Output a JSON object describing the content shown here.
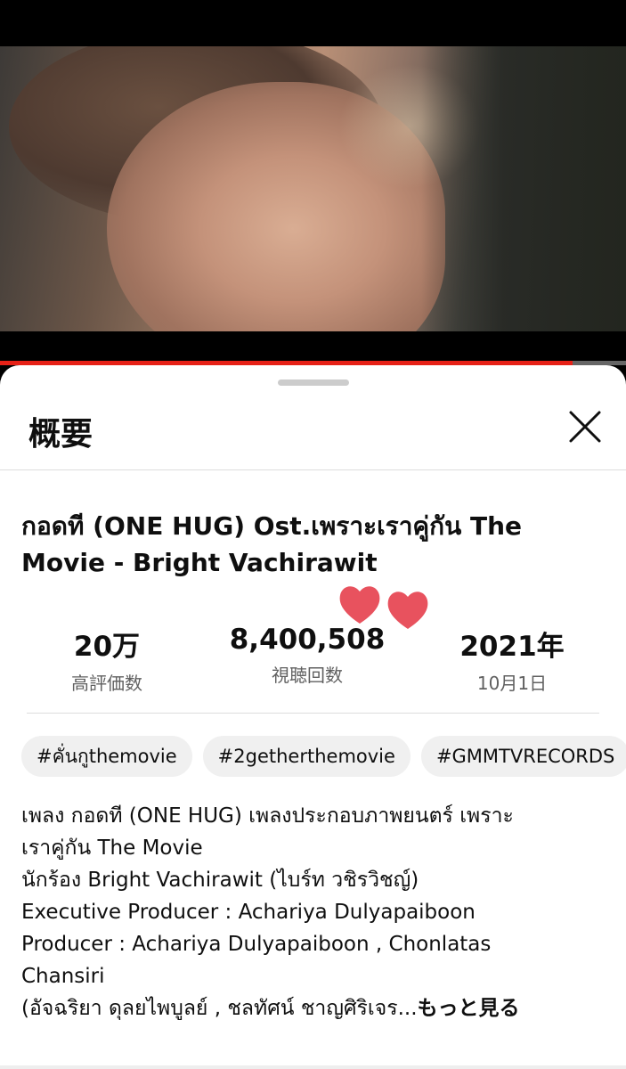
{
  "player": {
    "progress_fraction": 0.915,
    "accent_color": "#e62117"
  },
  "sheet": {
    "title": "概要",
    "close_icon": "close-icon"
  },
  "video": {
    "title_line1": "กอดที (ONE HUG) Ost.เพราะเราคู่กัน The",
    "title_line2": "Movie - Bright Vachirawit"
  },
  "stats": [
    {
      "value": "20万",
      "label": "高評価数"
    },
    {
      "value": "8,400,508",
      "label": "視聴回数"
    },
    {
      "value": "2021年",
      "label": "10月1日"
    }
  ],
  "tags": [
    "#คั่นกูthemovie",
    "#2getherthemovie",
    "#GMMTVRECORDS"
  ],
  "description": {
    "lines": [
      "เพลง กอดที (ONE HUG) เพลงประกอบภาพยนตร์ เพราะ",
      "เราคู่กัน The Movie",
      "นักร้อง Bright Vachirawit (ไบร์ท วชิรวิชญ์)",
      "Executive Producer : Achariya Dulyapaiboon",
      "Producer : Achariya Dulyapaiboon , Chonlatas",
      "Chansiri",
      "(อัจฉริยา ดุลยไพบูลย์ , ชลทัศน์ ชาญศิริเจร..."
    ],
    "more_label": "もっと見る"
  },
  "stickers": {
    "icon": "heart-sticker-icon",
    "color": "#e8525e"
  }
}
